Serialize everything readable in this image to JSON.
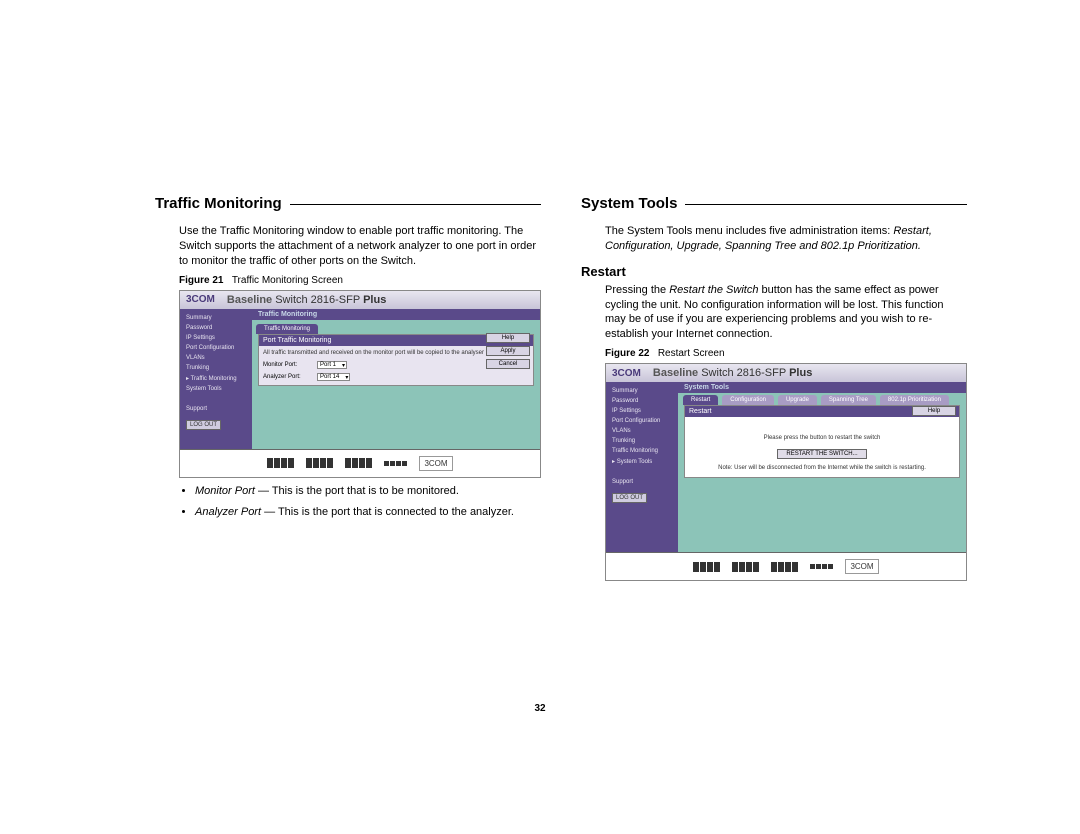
{
  "left": {
    "heading": "Traffic Monitoring",
    "para1": "Use the Traffic Monitoring window to enable port traffic monitoring. The Switch supports the attachment of a network analyzer to one port in order to monitor the traffic of other ports on the Switch.",
    "fig_label": "Figure 21",
    "fig_caption": "Traffic Monitoring Screen",
    "bullets": [
      {
        "term": "Monitor Port",
        "desc": " — This is the port that is to be monitored."
      },
      {
        "term": "Analyzer Port",
        "desc": " — This is the port that is connected to the analyzer."
      }
    ],
    "screenshot": {
      "brand": "3COM",
      "title_baseline": "Baseline",
      "title_switch": "Switch 2816-SFP",
      "title_plus": "Plus",
      "crumb": "Traffic Monitoring",
      "tab": "Traffic Monitoring",
      "panel_title": "Port Traffic Monitoring",
      "panel_text": "All traffic transmitted and received on the monitor port will be copied to the analyser port.",
      "monitor_label": "Monitor Port:",
      "monitor_value": "Port 1",
      "analyzer_label": "Analyzer Port:",
      "analyzer_value": "Port 14",
      "btn_help": "Help",
      "btn_apply": "Apply",
      "btn_cancel": "Cancel",
      "logout": "LOG OUT",
      "nav": [
        "Summary",
        "Password",
        "IP Settings",
        "Port Configuration",
        "VLANs",
        "Trunking",
        "Traffic Monitoring",
        "System Tools",
        "",
        "Support"
      ],
      "bottom_brand": "3COM"
    }
  },
  "right": {
    "heading": "System Tools",
    "para1": "The System Tools menu includes five administration items:",
    "para1_italic": "Restart, Configuration, Upgrade, Spanning Tree and 802.1p Prioritization.",
    "sub_heading": "Restart",
    "para2_a": "Pressing the ",
    "para2_i": "Restart the Switch",
    "para2_b": " button has the same effect as power cycling the unit. No configuration information will be lost. This function may be of use if you are experiencing problems and you wish to re-establish your Internet connection.",
    "fig_label": "Figure 22",
    "fig_caption": "Restart Screen",
    "screenshot": {
      "brand": "3COM",
      "title_baseline": "Baseline",
      "title_switch": "Switch 2816-SFP",
      "title_plus": "Plus",
      "crumb": "System Tools",
      "tabs": [
        "Restart",
        "Configuration",
        "Upgrade",
        "Spanning Tree",
        "802.1p Prioritization"
      ],
      "panel_title": "Restart",
      "panel_text": "Please press the button to restart the switch",
      "restart_btn": "RESTART THE SWITCH...",
      "note": "Note: User will be disconnected from the Internet while the switch is restarting.",
      "btn_help": "Help",
      "logout": "LOG OUT",
      "nav": [
        "Summary",
        "Password",
        "IP Settings",
        "Port Configuration",
        "VLANs",
        "Trunking",
        "Traffic Monitoring",
        "System Tools",
        "",
        "Support"
      ],
      "bottom_brand": "3COM"
    }
  },
  "page_number": "32"
}
